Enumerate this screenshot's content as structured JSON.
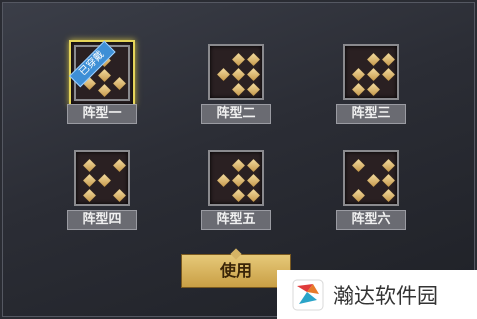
{
  "formations": [
    {
      "label": "阵型一",
      "selected": true,
      "badge": "已穿戴",
      "dots": [
        [
          1,
          0
        ],
        [
          1,
          1
        ],
        [
          0,
          1.5
        ],
        [
          1,
          2
        ],
        [
          2,
          1.5
        ]
      ]
    },
    {
      "label": "阵型二",
      "selected": false,
      "dots": [
        [
          1,
          0
        ],
        [
          2,
          0
        ],
        [
          0,
          1
        ],
        [
          1,
          1
        ],
        [
          2,
          1
        ],
        [
          1,
          2
        ],
        [
          2,
          2
        ]
      ]
    },
    {
      "label": "阵型三",
      "selected": false,
      "dots": [
        [
          1,
          0
        ],
        [
          2,
          0
        ],
        [
          0,
          1
        ],
        [
          1,
          1
        ],
        [
          2,
          1
        ],
        [
          0,
          2
        ],
        [
          1,
          2
        ]
      ]
    },
    {
      "label": "阵型四",
      "selected": false,
      "dots": [
        [
          0,
          0
        ],
        [
          2,
          0
        ],
        [
          0,
          1
        ],
        [
          1,
          1
        ],
        [
          0,
          2
        ],
        [
          2,
          2
        ]
      ]
    },
    {
      "label": "阵型五",
      "selected": false,
      "dots": [
        [
          1,
          0
        ],
        [
          2,
          0
        ],
        [
          0,
          1
        ],
        [
          1,
          1
        ],
        [
          2,
          1
        ],
        [
          1,
          2
        ],
        [
          2,
          2
        ]
      ]
    },
    {
      "label": "阵型六",
      "selected": false,
      "dots": [
        [
          0,
          0
        ],
        [
          2,
          0
        ],
        [
          1,
          1
        ],
        [
          2,
          1
        ],
        [
          0,
          2
        ],
        [
          2,
          2
        ]
      ]
    }
  ],
  "use_button": {
    "label": "使用"
  },
  "watermark": {
    "text": "瀚达软件园"
  }
}
